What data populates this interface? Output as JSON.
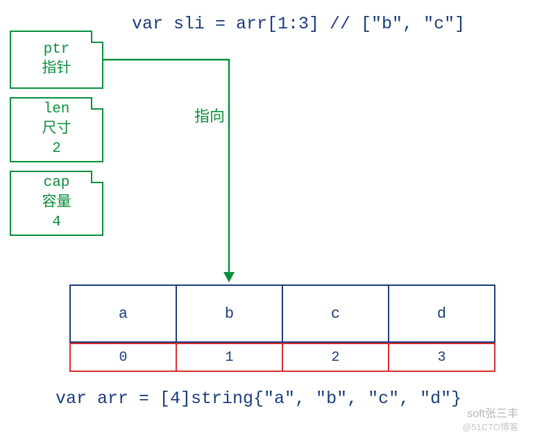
{
  "code_top": "var sli = arr[1:3] // [\"b\", \"c\"]",
  "slice_header": {
    "ptr": {
      "name": "ptr",
      "zh": "指针",
      "value": ""
    },
    "len": {
      "name": "len",
      "zh": "尺寸",
      "value": "2"
    },
    "cap": {
      "name": "cap",
      "zh": "容量",
      "value": "4"
    }
  },
  "arrow_label": "指向",
  "array": {
    "values": [
      "a",
      "b",
      "c",
      "d"
    ],
    "indices": [
      "0",
      "1",
      "2",
      "3"
    ]
  },
  "code_bottom": "var arr = [4]string{\"a\", \"b\", \"c\", \"d\"}",
  "watermark": {
    "line1": "soft张三丰",
    "line2": "@51CTO博客"
  },
  "chart_data": {
    "type": "table",
    "description": "Go slice header pointing into backing array",
    "slice_header_fields": [
      {
        "field": "ptr",
        "label_zh": "指针",
        "points_to_index": 1
      },
      {
        "field": "len",
        "label_zh": "尺寸",
        "value": 2
      },
      {
        "field": "cap",
        "label_zh": "容量",
        "value": 4
      }
    ],
    "backing_array": {
      "type": "[4]string",
      "values": [
        "a",
        "b",
        "c",
        "d"
      ]
    },
    "slice_expression": "arr[1:3]",
    "slice_result": [
      "b",
      "c"
    ]
  }
}
